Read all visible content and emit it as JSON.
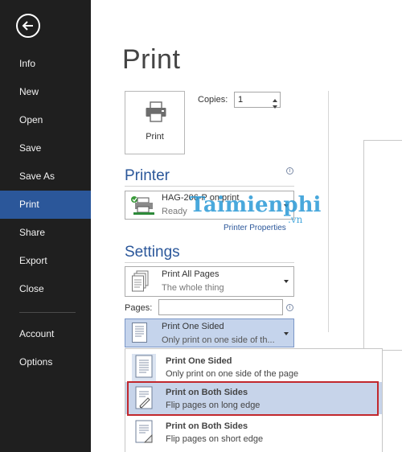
{
  "sidebar": {
    "items": [
      {
        "label": "Info"
      },
      {
        "label": "New"
      },
      {
        "label": "Open"
      },
      {
        "label": "Save"
      },
      {
        "label": "Save As"
      },
      {
        "label": "Print",
        "active": true
      },
      {
        "label": "Share"
      },
      {
        "label": "Export"
      },
      {
        "label": "Close"
      },
      {
        "label": "Account"
      },
      {
        "label": "Options"
      }
    ]
  },
  "page": {
    "title": "Print"
  },
  "print_button": {
    "label": "Print"
  },
  "copies": {
    "label": "Copies:",
    "value": "1"
  },
  "printer": {
    "heading": "Printer",
    "name": "HAG-206-P on print",
    "status": "Ready",
    "properties_link": "Printer Properties"
  },
  "settings": {
    "heading": "Settings",
    "print_range": {
      "title": "Print All Pages",
      "subtitle": "The whole thing"
    },
    "pages_label": "Pages:",
    "pages_value": "",
    "sides": {
      "title": "Print One Sided",
      "subtitle": "Only print on one side of th..."
    }
  },
  "sides_menu": {
    "options": [
      {
        "title": "Print One Sided",
        "subtitle": "Only print on one side of the page"
      },
      {
        "title": "Print on Both Sides",
        "subtitle": "Flip pages on long edge"
      },
      {
        "title": "Print on Both Sides",
        "subtitle": "Flip pages on short edge"
      }
    ]
  },
  "watermark": {
    "text": "Taimienphi",
    "suffix": ".vn"
  },
  "colors": {
    "sidebar": "#1f1f1f",
    "accent": "#2b579a",
    "selection": "#c7d4ea",
    "highlight_border": "#c2282d"
  }
}
